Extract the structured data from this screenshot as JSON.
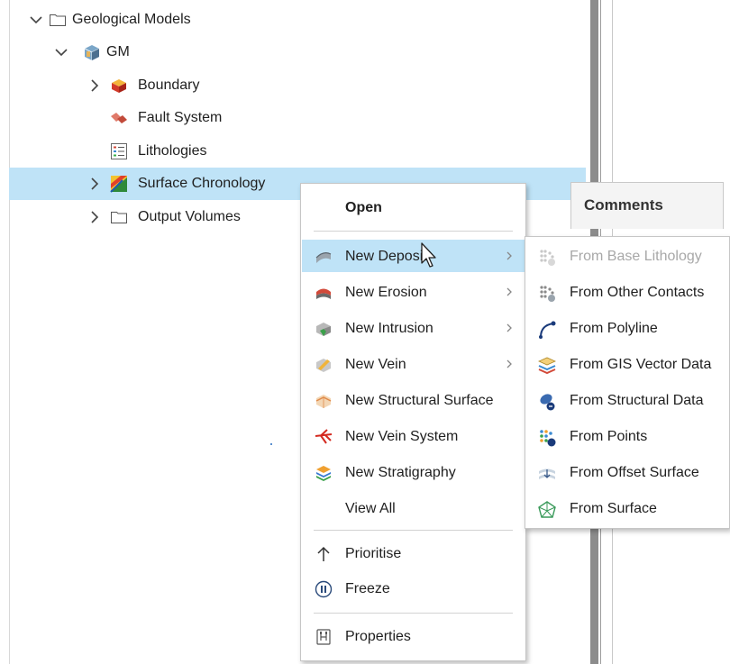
{
  "tree": {
    "items": [
      {
        "label": "Geological Models",
        "icon": "folder-icon"
      },
      {
        "label": "GM",
        "icon": "geological-model-icon"
      },
      {
        "label": "Boundary",
        "icon": "boundary-icon"
      },
      {
        "label": "Fault System",
        "icon": "fault-system-icon"
      },
      {
        "label": "Lithologies",
        "icon": "lithologies-icon"
      },
      {
        "label": "Surface Chronology",
        "icon": "surface-chronology-icon",
        "selected": true
      },
      {
        "label": "Output Volumes",
        "icon": "folder-icon"
      }
    ]
  },
  "comments_header": "Comments",
  "context_menu": {
    "open": "Open",
    "items": [
      {
        "label": "New Deposit",
        "icon": "deposit-icon",
        "submenu": true
      },
      {
        "label": "New Erosion",
        "icon": "erosion-icon",
        "submenu": true
      },
      {
        "label": "New Intrusion",
        "icon": "intrusion-icon",
        "submenu": true
      },
      {
        "label": "New Vein",
        "icon": "vein-icon",
        "submenu": true
      },
      {
        "label": "New Structural Surface",
        "icon": "structural-surface-icon"
      },
      {
        "label": "New Vein System",
        "icon": "vein-system-icon"
      },
      {
        "label": "New Stratigraphy",
        "icon": "stratigraphy-icon"
      },
      {
        "label": "View All",
        "icon": ""
      }
    ],
    "prioritise": "Prioritise",
    "freeze": "Freeze",
    "properties": "Properties"
  },
  "submenu": {
    "items": [
      {
        "label": "From Base Lithology",
        "icon": "base-lithology-icon",
        "disabled": true
      },
      {
        "label": "From Other Contacts",
        "icon": "other-contacts-icon"
      },
      {
        "label": "From Polyline",
        "icon": "polyline-icon"
      },
      {
        "label": "From GIS Vector Data",
        "icon": "gis-vector-data-icon"
      },
      {
        "label": "From Structural Data",
        "icon": "structural-data-icon"
      },
      {
        "label": "From Points",
        "icon": "points-icon"
      },
      {
        "label": "From Offset Surface",
        "icon": "offset-surface-icon"
      },
      {
        "label": "From Surface",
        "icon": "surface-icon"
      }
    ]
  },
  "colors": {
    "selection": "#bfe3f7",
    "splitter": "#8c8c8c",
    "disabled_text": "#a8a8a8"
  }
}
